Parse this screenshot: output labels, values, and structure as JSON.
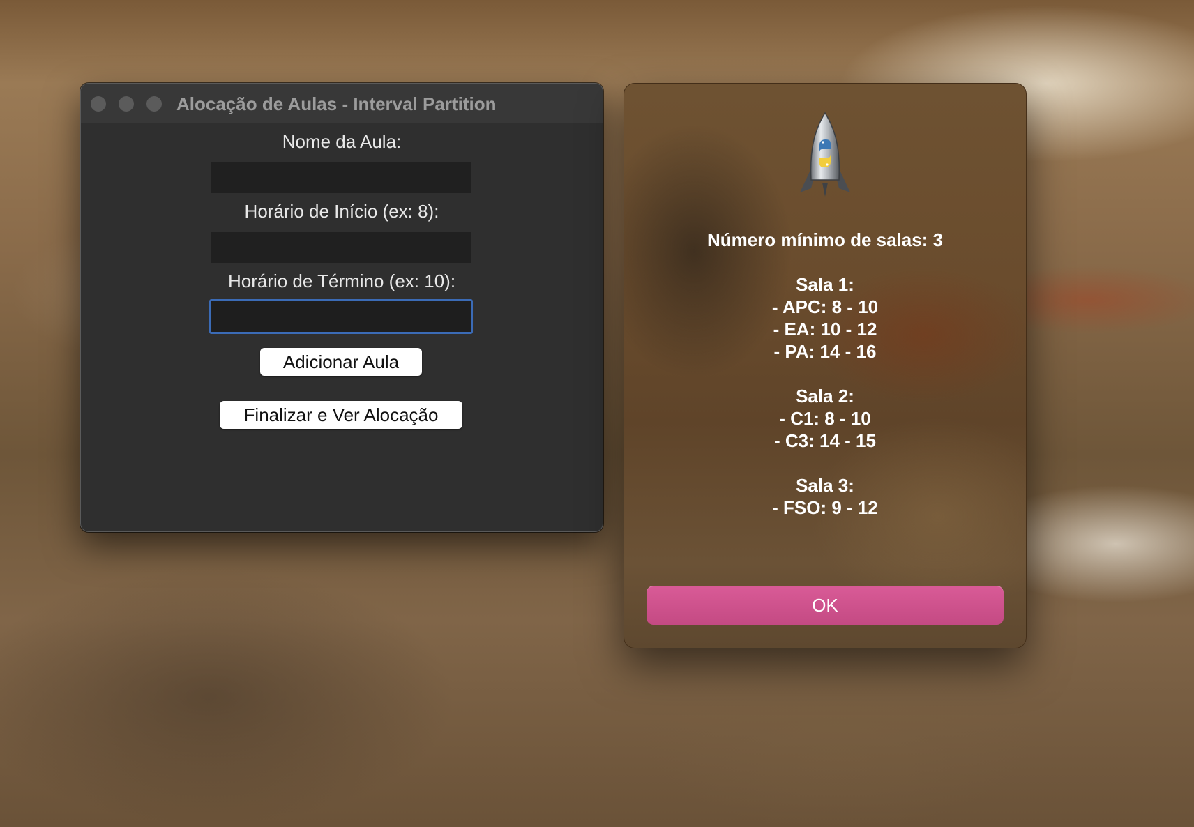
{
  "app_window": {
    "title": "Alocação de Aulas - Interval Partition",
    "fields": [
      {
        "label": "Nome da Aula:",
        "value": "",
        "focused": false
      },
      {
        "label": "Horário de Início (ex: 8):",
        "value": "",
        "focused": false
      },
      {
        "label": "Horário de Término (ex: 10):",
        "value": "",
        "focused": true
      }
    ],
    "add_button_label": "Adicionar Aula",
    "finish_button_label": "Finalizar e Ver Alocação"
  },
  "alert": {
    "icon": "python-launcher-rocket-icon",
    "summary": "Número mínimo de salas: 3",
    "rooms": [
      {
        "name": "Sala 1:",
        "classes": [
          "- APC: 8 - 10",
          "- EA: 10 - 12",
          "- PA: 14 - 16"
        ]
      },
      {
        "name": "Sala 2:",
        "classes": [
          "- C1: 8 - 10",
          "- C3: 14 - 15"
        ]
      },
      {
        "name": "Sala 3:",
        "classes": [
          "- FSO: 9 - 12"
        ]
      }
    ],
    "ok_label": "OK"
  },
  "colors": {
    "accent_focus": "#3b6bb6",
    "ok_button": "#d0528d",
    "window_bg": "#2f2f2f"
  }
}
